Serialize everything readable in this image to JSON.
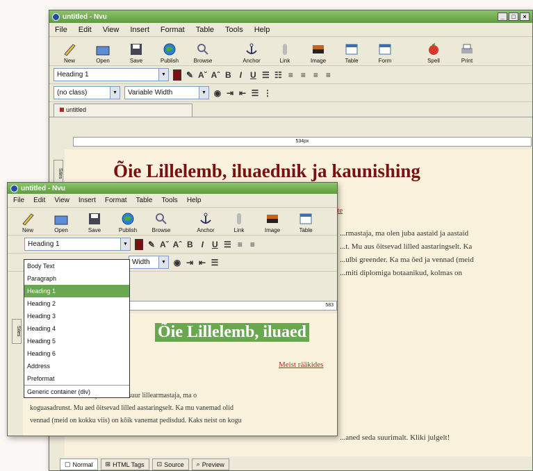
{
  "back": {
    "title": "untitled - Nvu",
    "menu": [
      "File",
      "Edit",
      "View",
      "Insert",
      "Format",
      "Table",
      "Tools",
      "Help"
    ],
    "toolbar": [
      "New",
      "Open",
      "Save",
      "Publish",
      "Browse",
      "Anchor",
      "Link",
      "Image",
      "Table",
      "Form",
      "Spell",
      "Print"
    ],
    "paragraph_format": "Heading 1",
    "class_select": "(no class)",
    "font_select": "Variable Width",
    "doc_tab": "untitled",
    "ruler": "534px",
    "heading": "Õie Lillelemb, iluaednik ja kaunishing",
    "link": "...rgte",
    "body_lines": [
      "...rmastaja, ma olen juba aastaid ja aastaid",
      "...t. Mu aus õitsevad lilled aastaringselt. Ka",
      "...ulbi greender. Ka ma õed ja vennad (meid",
      "...miti diplomiga botaanikud, kolmas on"
    ],
    "bottom_text": "...aned seda suurimalt. Kliki julgelt!",
    "side_tab": "Sites",
    "bottom_tabs": [
      "Normal",
      "HTML Tags",
      "Source",
      "Preview"
    ]
  },
  "front": {
    "title": "untitled - Nvu",
    "menu": [
      "File",
      "Edit",
      "View",
      "Insert",
      "Format",
      "Table",
      "Tools",
      "Help"
    ],
    "toolbar": [
      "New",
      "Open",
      "Save",
      "Publish",
      "Browse",
      "Anchor",
      "Link",
      "Image",
      "Table"
    ],
    "paragraph_format": "Heading 1",
    "font_select": "Width",
    "ruler": "583",
    "heading": "Õie Lillelemb, iluaed",
    "link": "Meist rääkides",
    "body_lines": [
      "...bor väikese maja. Ma olen suur lillearmastaja, ma o",
      "koguasadrunst. Mu aed õitsevad lilled aastaringselt. Ka mu vanemad olid",
      "vennad (meid on kokku viis) on kõik vanemat pedisdud. Kaks neist on kogu"
    ],
    "side_tab": "Sites",
    "dropdown": [
      "Body Text",
      "Paragraph",
      "Heading 1",
      "Heading 2",
      "Heading 3",
      "Heading 4",
      "Heading 5",
      "Heading 6",
      "Address",
      "Preformat",
      "Generic container (div)"
    ],
    "dropdown_selected": 2
  }
}
